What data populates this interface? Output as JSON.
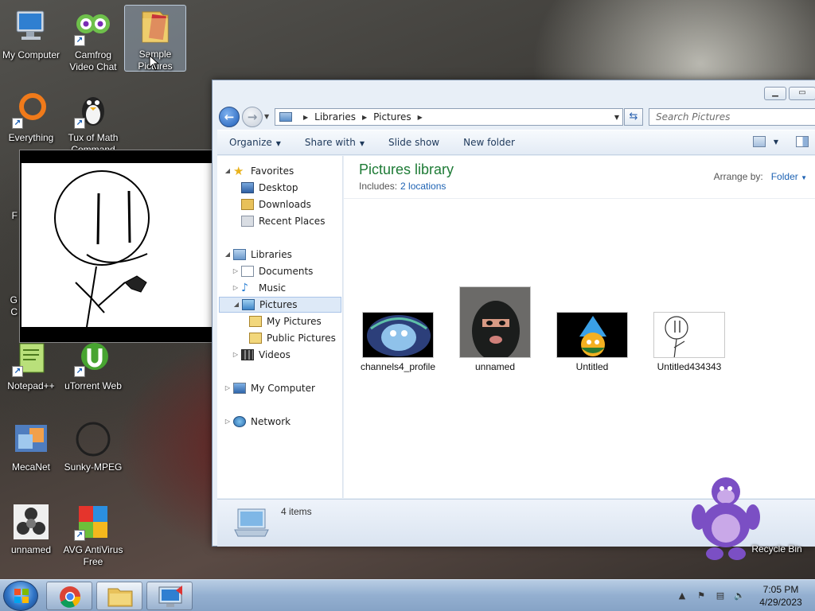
{
  "desktop": {
    "icons": [
      {
        "label": "My Computer"
      },
      {
        "label": "Camfrog Video Chat"
      },
      {
        "label": "Sample Pictures"
      },
      {
        "label": "Everything"
      },
      {
        "label": "Tux of Math Command"
      },
      {
        "label": "Notepad++"
      },
      {
        "label": "uTorrent Web"
      },
      {
        "label": "MecaNet"
      },
      {
        "label": "Sunky-MPEG"
      },
      {
        "label": "unnamed"
      },
      {
        "label": "AVG AntiVirus Free"
      },
      {
        "label": "Recycle Bin"
      }
    ],
    "partial_labels": [
      "F",
      "G",
      "C"
    ]
  },
  "explorer": {
    "breadcrumb": [
      "Libraries",
      "Pictures"
    ],
    "search_placeholder": "Search Pictures",
    "toolbar": {
      "organize": "Organize",
      "share_with": "Share with",
      "slide_show": "Slide show",
      "new_folder": "New folder"
    },
    "nav": {
      "favorites": "Favorites",
      "desktop": "Desktop",
      "downloads": "Downloads",
      "recent_places": "Recent Places",
      "libraries": "Libraries",
      "documents": "Documents",
      "music": "Music",
      "pictures": "Pictures",
      "my_pictures": "My Pictures",
      "public_pictures": "Public Pictures",
      "videos": "Videos",
      "my_computer": "My Computer",
      "network": "Network"
    },
    "content": {
      "title": "Pictures library",
      "includes_label": "Includes:",
      "includes_link": "2 locations",
      "arrange_label": "Arrange by:",
      "arrange_value": "Folder",
      "files": [
        {
          "name": "channels4_profile"
        },
        {
          "name": "unnamed"
        },
        {
          "name": "Untitled"
        },
        {
          "name": "Untitled434343"
        }
      ]
    },
    "details": {
      "count": "4 items"
    }
  },
  "taskbar": {
    "time": "7:05 PM",
    "date": "4/29/2023",
    "pinned": [
      "chrome-icon",
      "windows-explorer-icon",
      "remote-desktop-icon"
    ]
  }
}
